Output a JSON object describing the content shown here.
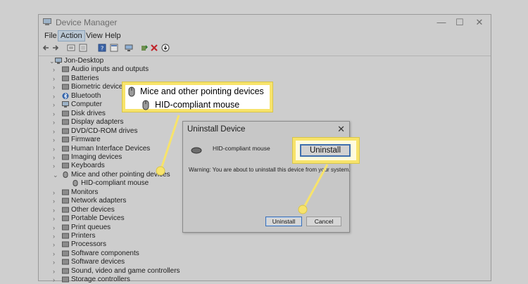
{
  "window": {
    "title": "Device Manager",
    "controls": [
      "—",
      "☐",
      "✕"
    ]
  },
  "menu": {
    "items": [
      "File",
      "Action",
      "View",
      "Help"
    ],
    "active": "Action"
  },
  "tree": {
    "root": "Jon-Desktop",
    "items": [
      {
        "label": "Audio inputs and outputs",
        "icon": "speaker-icon"
      },
      {
        "label": "Batteries",
        "icon": "battery-icon"
      },
      {
        "label": "Biometric devices",
        "icon": "biometric-icon"
      },
      {
        "label": "Bluetooth",
        "icon": "bluetooth-icon"
      },
      {
        "label": "Computer",
        "icon": "computer-icon"
      },
      {
        "label": "Disk drives",
        "icon": "disk-icon"
      },
      {
        "label": "Display adapters",
        "icon": "display-icon"
      },
      {
        "label": "DVD/CD-ROM drives",
        "icon": "dvd-icon"
      },
      {
        "label": "Firmware",
        "icon": "firmware-icon"
      },
      {
        "label": "Human Interface Devices",
        "icon": "hid-icon"
      },
      {
        "label": "Imaging devices",
        "icon": "camera-icon"
      },
      {
        "label": "Keyboards",
        "icon": "keyboard-icon"
      },
      {
        "label": "Mice and other pointing devices",
        "icon": "mouse-icon",
        "expanded": true
      },
      {
        "label": "HID-compliant mouse",
        "icon": "mouse-icon",
        "child": true
      },
      {
        "label": "Monitors",
        "icon": "monitor-icon"
      },
      {
        "label": "Network adapters",
        "icon": "network-icon"
      },
      {
        "label": "Other devices",
        "icon": "other-device-icon"
      },
      {
        "label": "Portable Devices",
        "icon": "portable-device-icon"
      },
      {
        "label": "Print queues",
        "icon": "printer-icon"
      },
      {
        "label": "Printers",
        "icon": "printer-icon"
      },
      {
        "label": "Processors",
        "icon": "processor-icon"
      },
      {
        "label": "Software components",
        "icon": "software-icon"
      },
      {
        "label": "Software devices",
        "icon": "software-icon"
      },
      {
        "label": "Sound, video and game controllers",
        "icon": "speaker-icon"
      },
      {
        "label": "Storage controllers",
        "icon": "storage-icon"
      }
    ]
  },
  "callout": {
    "category": "Mice and other pointing devices",
    "device": "HID-compliant mouse"
  },
  "dialog": {
    "title": "Uninstall Device",
    "close": "✕",
    "device_name": "HID-compliant mouse",
    "warning": "Warning: You are about to uninstall this device from your system.",
    "uninstall_label": "Uninstall",
    "cancel_label": "Cancel"
  },
  "zoom_callout": {
    "button_label": "Uninstall"
  },
  "colors": {
    "highlight": "#f7e36b",
    "focus_blue": "#3f6fae"
  }
}
